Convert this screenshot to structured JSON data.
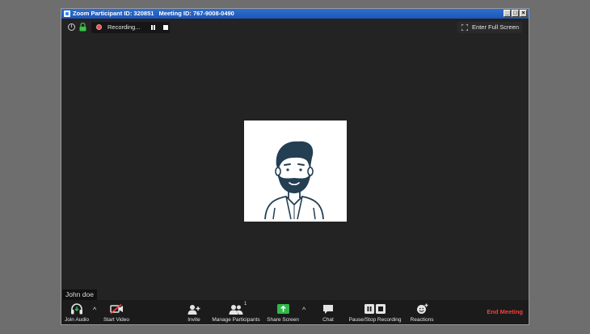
{
  "window": {
    "participant_id": "Zoom Participant ID: 320851",
    "meeting_id": "Meeting ID: 767-9008-0490",
    "minimize": "_",
    "maximize": "□",
    "close": "×"
  },
  "recording": {
    "label": "Recording..."
  },
  "fullscreen": {
    "label": "Enter Full Screen"
  },
  "participant": {
    "name": "John doe"
  },
  "toolbar": {
    "join_audio": "Join Audio",
    "start_video": "Start Video",
    "invite": "Invite",
    "manage_participants": "Manage Participants",
    "participant_count": "1",
    "share_screen": "Share Screen",
    "chat": "Chat",
    "pause_stop_recording": "Pause/Stop Recording",
    "reactions": "Reactions",
    "end_meeting": "End Meeting"
  },
  "colors": {
    "accent_green": "#2fb94a",
    "end_red": "#ff3b3b",
    "recording_red": "#e85050",
    "lock_green": "#3cc34a"
  }
}
